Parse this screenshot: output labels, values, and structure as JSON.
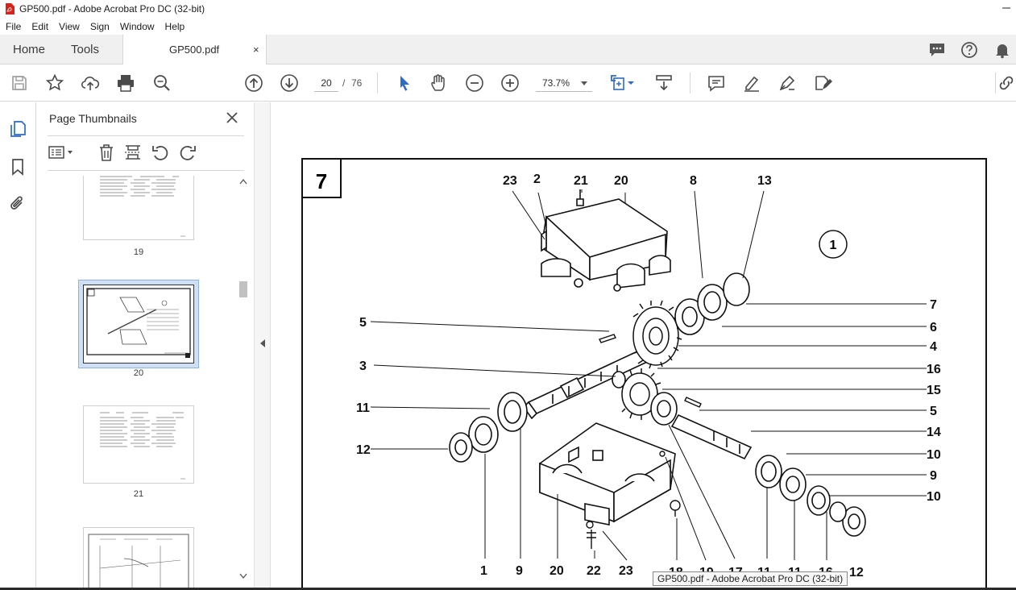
{
  "window": {
    "title": "GP500.pdf - Adobe Acrobat Pro DC (32-bit)"
  },
  "menu": [
    "File",
    "Edit",
    "View",
    "Sign",
    "Window",
    "Help"
  ],
  "tabs": {
    "home": "Home",
    "tools": "Tools",
    "doc": "GP500.pdf",
    "close": "×"
  },
  "toolbar": {
    "page_current": "20",
    "page_separator": "/",
    "page_total": "76",
    "zoom": "73.7%"
  },
  "panel": {
    "title": "Page Thumbnails",
    "thumbnails": [
      {
        "label": "19"
      },
      {
        "label": "20",
        "selected": true
      },
      {
        "label": "21"
      }
    ]
  },
  "drawing": {
    "figure_number": "7",
    "circle_label": "1",
    "callouts": [
      "23",
      "2",
      "21",
      "20",
      "8",
      "13",
      "7",
      "6",
      "4",
      "16",
      "15",
      "5",
      "14",
      "10",
      "9",
      "10",
      "12",
      "16",
      "11",
      "11",
      "17",
      "19",
      "18",
      "23",
      "22",
      "20",
      "9",
      "1",
      "12",
      "11",
      "3",
      "5"
    ]
  },
  "tooltip": "GP500.pdf - Adobe Acrobat Pro DC (32-bit)",
  "colors": {
    "accent_blue": "#2d6bc8",
    "chrome": "#f0f0f0",
    "icon_gray": "#4b4b4b",
    "pdf_red": "#d8231b"
  }
}
